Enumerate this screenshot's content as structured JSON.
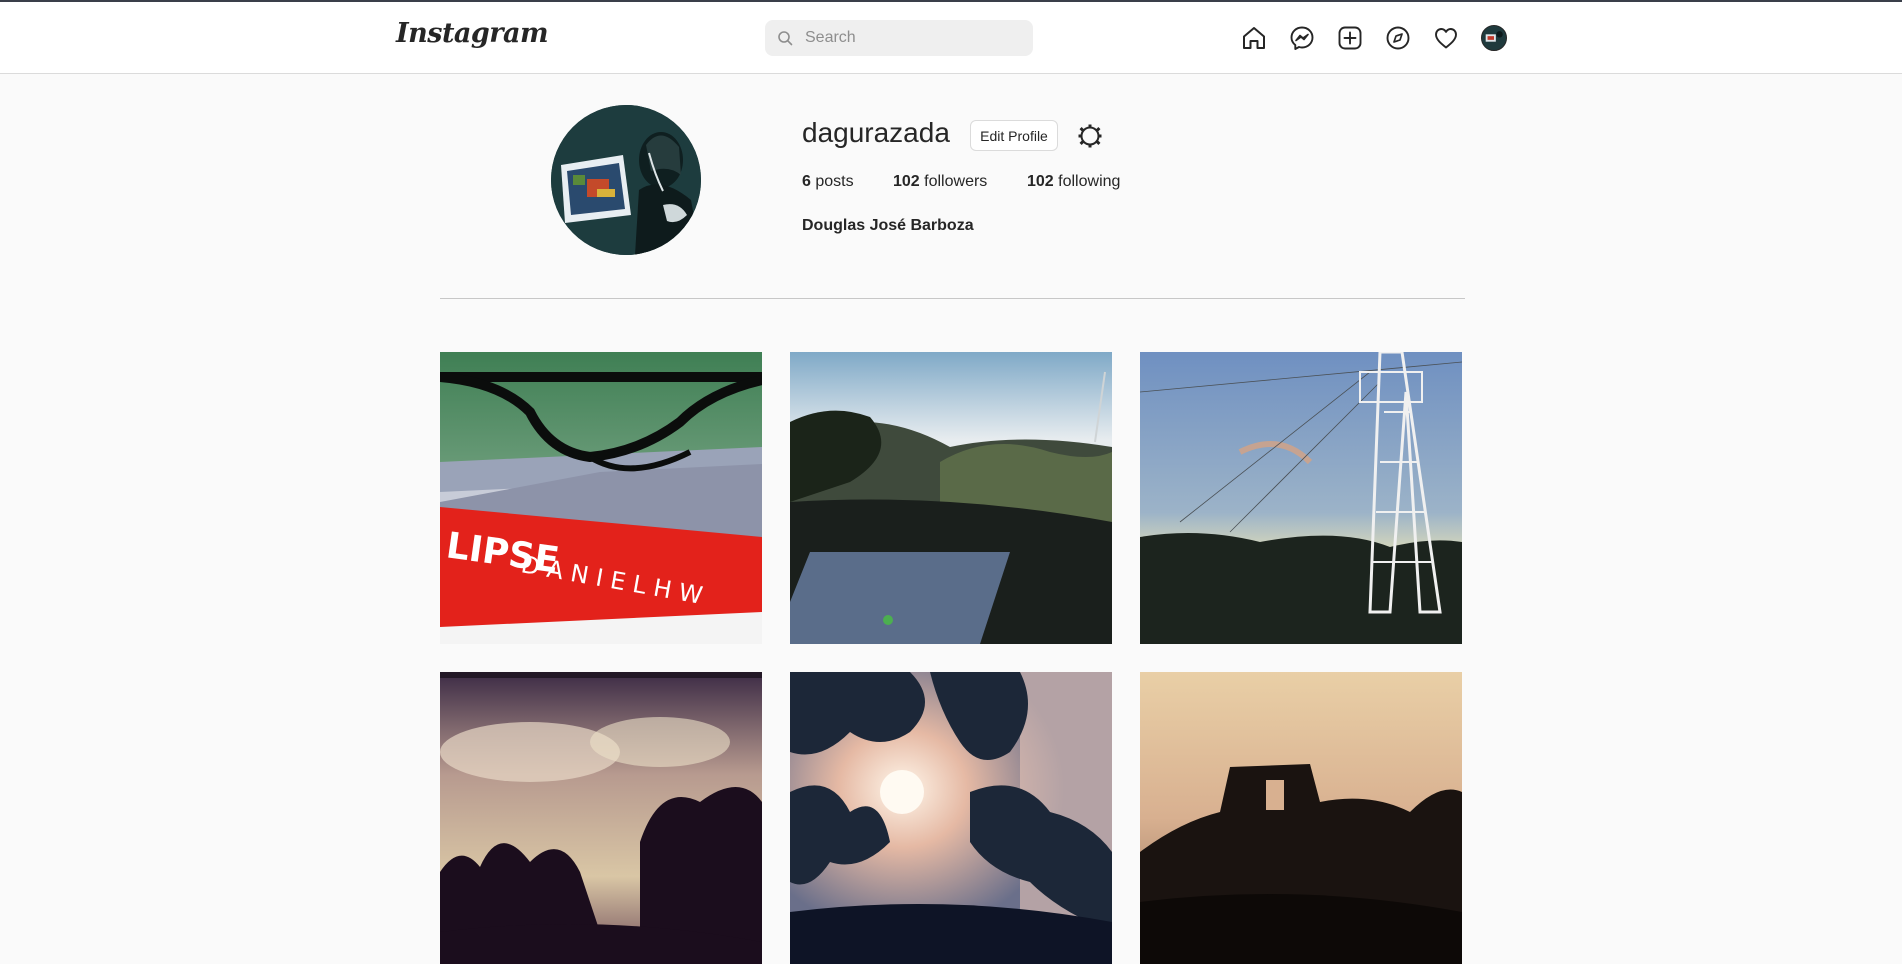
{
  "app": {
    "logo_text": "Instagram"
  },
  "search": {
    "placeholder": "Search",
    "icon": "search-icon"
  },
  "nav": {
    "icons": [
      "home-icon",
      "messenger-icon",
      "new-post-icon",
      "explore-icon",
      "activity-heart-icon",
      "profile-avatar-icon"
    ]
  },
  "profile": {
    "username": "dagurazada",
    "edit_label": "Edit Profile",
    "settings_icon": "gear-icon",
    "stats": {
      "posts_count": "6",
      "posts_label": "posts",
      "followers_count": "102",
      "followers_label": "followers",
      "following_count": "102",
      "following_label": "following"
    },
    "full_name": "Douglas José Barboza"
  },
  "posts": [
    {
      "subject": "glasses on red book"
    },
    {
      "subject": "hazy hillside with solar panel"
    },
    {
      "subject": "transmission tower at dusk"
    },
    {
      "subject": "clouds over tree silhouettes"
    },
    {
      "subject": "sun through tree leaves"
    },
    {
      "subject": "hilltop ruins silhouette"
    }
  ],
  "colors": {
    "background": "#fafafa",
    "navbar": "#ffffff",
    "border": "#dbdbdb",
    "text": "#262626",
    "muted": "#8e8e8e"
  }
}
